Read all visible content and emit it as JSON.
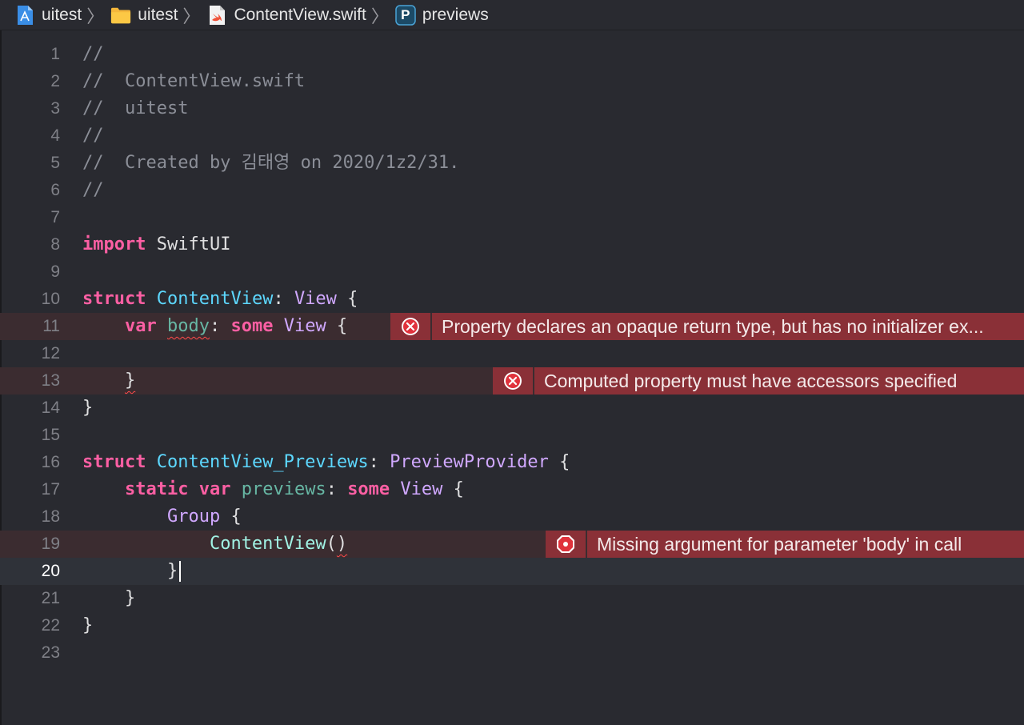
{
  "breadcrumb": {
    "project": "uitest",
    "folder": "uitest",
    "file": "ContentView.swift",
    "symbol_badge": "P",
    "symbol": "previews"
  },
  "line_numbers": [
    "1",
    "2",
    "3",
    "4",
    "5",
    "6",
    "7",
    "8",
    "9",
    "10",
    "11",
    "12",
    "13",
    "14",
    "15",
    "16",
    "17",
    "18",
    "19",
    "20",
    "21",
    "22",
    "23"
  ],
  "code": {
    "l1": "//",
    "l2": "//  ContentView.swift",
    "l3": "//  uitest",
    "l4": "//",
    "l5": "//  Created by 김태영 on 2020/1z2/31.",
    "l6": "//",
    "l8_kw": "import",
    "l8_mod": " SwiftUI",
    "l10_kw": "struct",
    "l10_name": "ContentView",
    "l10_colon": ": ",
    "l10_type": "View",
    "l10_brace": " {",
    "l11_indent": "    ",
    "l11_kw": "var",
    "l11_name": "body",
    "l11_colon": ": ",
    "l11_kw2": "some",
    "l11_type": "View",
    "l11_brace": " {",
    "l13_indent": "    ",
    "l13_brace": "}",
    "l14": "}",
    "l16_kw": "struct",
    "l16_name": "ContentView_Previews",
    "l16_colon": ": ",
    "l16_type": "PreviewProvider",
    "l16_brace": " {",
    "l17_indent": "    ",
    "l17_kw": "static",
    "l17_kw2": "var",
    "l17_name": "previews",
    "l17_colon": ": ",
    "l17_kw3": "some",
    "l17_type": "View",
    "l17_brace": " {",
    "l18_indent": "        ",
    "l18_type": "Group",
    "l18_brace": " {",
    "l19_indent": "            ",
    "l19_call": "ContentView",
    "l19_open": "(",
    "l19_close": ")",
    "l20_indent": "        ",
    "l20_brace": "}",
    "l21": "    }",
    "l22": "}"
  },
  "errors": {
    "e11": "Property declares an opaque return type, but has no initializer ex...",
    "e13": "Computed property must have accessors specified",
    "e19": "Missing argument for parameter 'body' in call"
  },
  "colors": {
    "background": "#292a30",
    "keyword": "#fc5fa3",
    "type_decl": "#5dd8ff",
    "system_type": "#d0a8ff",
    "comment": "#8b8e97",
    "error_banner": "#8a3037",
    "error_line": "#3b2c30"
  },
  "icons": {
    "project": "xcode-project-icon",
    "folder": "folder-icon",
    "file": "swift-file-icon",
    "symbol": "property-badge-icon",
    "error": "error-x-icon",
    "error_stop": "error-stop-icon"
  }
}
